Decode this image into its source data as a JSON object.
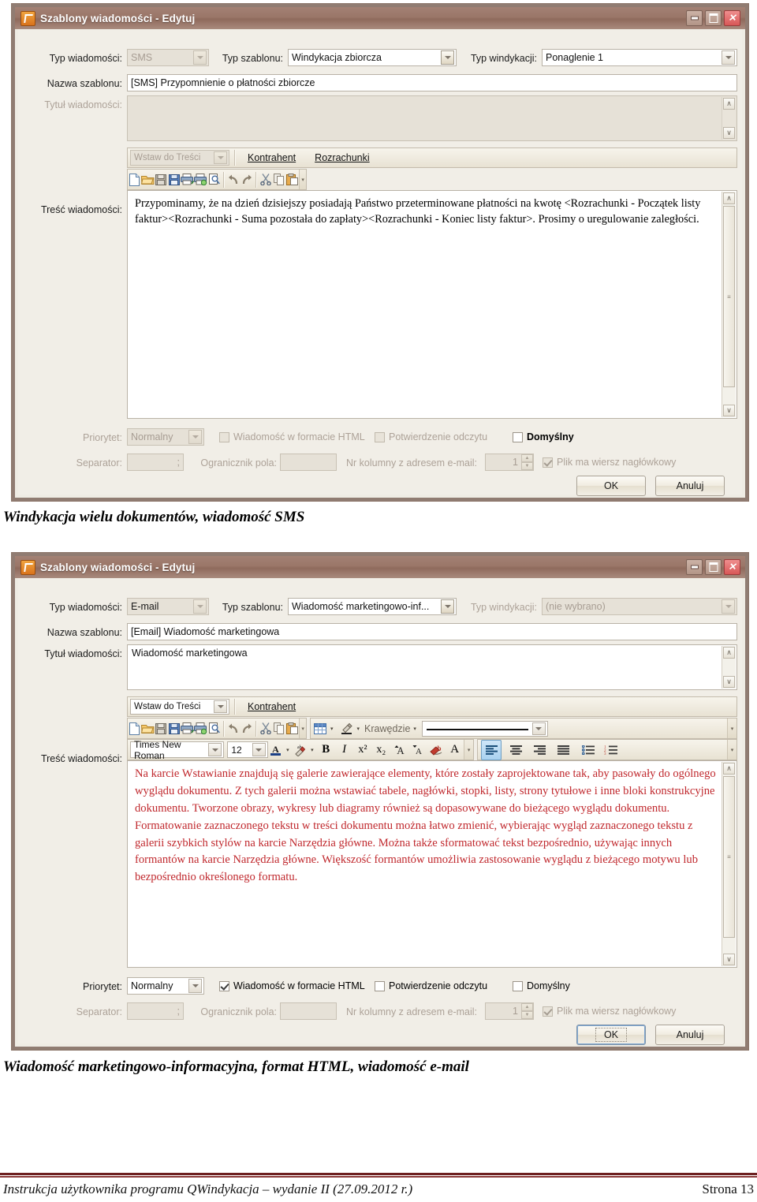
{
  "document": {
    "caption_1": "Windykacja wielu dokumentów, wiadomość SMS",
    "caption_2": "Wiadomość marketingowo-informacyjna, format HTML, wiadomość e-mail",
    "footer_text": "Instrukcja użytkownika programu QWindykacja – wydanie II (27.09.2012 r.)",
    "footer_page": "Strona 13"
  },
  "colors": {
    "titlebar": "#9a7668",
    "dialog_bg": "#f1eee7",
    "accent_red": "#c0282d",
    "footer_rule": "#6d2020",
    "field_bg": "#ffffff",
    "disabled_bg": "#e6e1d7"
  },
  "dialog_sms": {
    "title": "Szablony wiadomości - Edytuj",
    "window_buttons": {
      "minimize": "minimize-icon",
      "maximize": "maximize-icon",
      "close": "close-icon"
    },
    "fields": {
      "msg_type_label": "Typ wiadomości:",
      "msg_type_value": "SMS",
      "template_type_label": "Typ szablonu:",
      "template_type_value": "Windykacja zbiorcza",
      "dunning_type_label": "Typ windykacji:",
      "dunning_type_value": "Ponaglenie 1",
      "template_name_label": "Nazwa szablonu:",
      "template_name_value": "[SMS] Przypomnienie o płatności zbiorcze",
      "msg_title_label": "Tytuł wiadomości:",
      "msg_title_value": "",
      "msg_body_label": "Treść wiadomości:"
    },
    "insert_toolbar": {
      "insert_combo": "Wstaw do Treści",
      "links": [
        "Kontrahent",
        "Rozrachunki"
      ]
    },
    "file_toolbar_icons": [
      "new-document-icon",
      "open-folder-icon",
      "save-icon",
      "save-as-icon",
      "print-icon",
      "print-preview-icon",
      "find-icon",
      "undo-icon",
      "redo-icon",
      "cut-icon",
      "copy-icon",
      "paste-icon",
      "overflow-icon"
    ],
    "body_text": "Przypominamy, że na dzień dzisiejszy posiadają Państwo przeterminowane płatności na kwotę <Rozrachunki - Początek listy faktur><Rozrachunki - Suma pozostała do zapłaty><Rozrachunki - Koniec listy faktur>. Prosimy o uregulowanie zaległości.",
    "options": {
      "priority_label": "Priorytet:",
      "priority_value": "Normalny",
      "html_format_label": "Wiadomość w formacie HTML",
      "html_format_checked": false,
      "read_receipt_label": "Potwierdzenie odczytu",
      "read_receipt_checked": false,
      "default_label": "Domyślny",
      "default_checked": false,
      "separator_label": "Separator:",
      "separator_value": ";",
      "field_delimiter_label": "Ogranicznik pola:",
      "field_delimiter_value": "",
      "email_column_label": "Nr kolumny z adresem e-mail:",
      "email_column_value": "1",
      "header_row_label": "Plik ma wiersz nagłówkowy",
      "header_row_checked": true
    },
    "buttons": {
      "ok": "OK",
      "cancel": "Anuluj"
    }
  },
  "dialog_email": {
    "title": "Szablony wiadomości - Edytuj",
    "window_buttons": {
      "minimize": "minimize-icon",
      "maximize": "maximize-icon",
      "close": "close-icon"
    },
    "fields": {
      "msg_type_label": "Typ wiadomości:",
      "msg_type_value": "E-mail",
      "template_type_label": "Typ szablonu:",
      "template_type_value": "Wiadomość marketingowo-inf...",
      "dunning_type_label": "Typ windykacji:",
      "dunning_type_value": "(nie wybrano)",
      "template_name_label": "Nazwa szablonu:",
      "template_name_value": "[Email] Wiadomość marketingowa",
      "msg_title_label": "Tytuł wiadomości:",
      "msg_title_value": "Wiadomość marketingowa",
      "msg_body_label": "Treść wiadomości:"
    },
    "insert_toolbar": {
      "insert_combo": "Wstaw do Treści",
      "links": [
        "Kontrahent"
      ]
    },
    "file_toolbar_icons": [
      "new-document-icon",
      "open-folder-icon",
      "save-icon",
      "save-as-icon",
      "print-icon",
      "print-preview-icon",
      "find-icon",
      "undo-icon",
      "redo-icon",
      "cut-icon",
      "copy-icon",
      "paste-icon",
      "overflow-icon"
    ],
    "table_toolbar": {
      "table_icon": "insert-table-icon",
      "shading_icon": "shading-icon",
      "borders_label": "Krawędzie",
      "line_style_value": "",
      "overflow": "overflow-icon"
    },
    "font_toolbar": {
      "font_family": "Times New Roman",
      "font_size": "12",
      "font_color_icon": "font-color-icon",
      "highlight_icon": "text-highlight-icon",
      "bold": "B",
      "italic": "I",
      "superscript": "x²",
      "subscript": "x₂",
      "grow_font_icon": "grow-font-icon",
      "shrink_font_icon": "shrink-font-icon",
      "clear_format_icon": "clear-formatting-icon",
      "change_case_icon": "change-case-icon",
      "align_left_icon": "align-left-icon",
      "align_center_icon": "align-center-icon",
      "align_right_icon": "align-right-icon",
      "align_justify_icon": "align-justify-icon",
      "bullet_list_icon": "bullet-list-icon",
      "numbered_list_icon": "numbered-list-icon"
    },
    "body_text": "Na karcie Wstawianie znajdują się galerie zawierające elementy, które zostały zaprojektowane tak, aby pasowały do ogólnego wyglądu dokumentu. Z tych galerii można wstawiać tabele, nagłówki, stopki, listy, strony tytułowe i inne bloki konstrukcyjne dokumentu. Tworzone obrazy, wykresy lub diagramy również są dopasowywane do bieżącego wyglądu dokumentu. Formatowanie zaznaczonego tekstu w treści dokumentu można łatwo zmienić, wybierając wygląd zaznaczonego tekstu z galerii szybkich stylów na karcie Narzędzia główne. Można także sformatować tekst bezpośrednio, używając innych formantów na karcie Narzędzia główne. Większość formantów umożliwia zastosowanie wyglądu z bieżącego motywu lub bezpośrednio określonego formatu.",
    "options": {
      "priority_label": "Priorytet:",
      "priority_value": "Normalny",
      "html_format_label": "Wiadomość w formacie HTML",
      "html_format_checked": true,
      "read_receipt_label": "Potwierdzenie odczytu",
      "read_receipt_checked": false,
      "default_label": "Domyślny",
      "default_checked": false,
      "separator_label": "Separator:",
      "separator_value": ";",
      "field_delimiter_label": "Ogranicznik pola:",
      "field_delimiter_value": "",
      "email_column_label": "Nr kolumny z adresem e-mail:",
      "email_column_value": "1",
      "header_row_label": "Plik ma wiersz nagłówkowy",
      "header_row_checked": true
    },
    "buttons": {
      "ok": "OK",
      "cancel": "Anuluj"
    }
  }
}
